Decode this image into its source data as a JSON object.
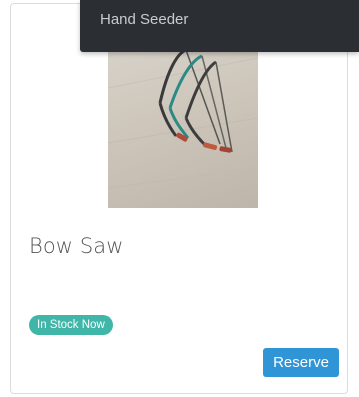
{
  "product": {
    "name": "Bow Saw",
    "stock_status": "In Stock Now",
    "reserve_label": "Reserve",
    "image_alt": "bow saws"
  },
  "menu": {
    "items": [
      {
        "label": "Hand Seeder"
      }
    ]
  },
  "colors": {
    "badge": "#3fb6a8",
    "button": "#3095d6",
    "menu_bg": "#2b2f33"
  }
}
